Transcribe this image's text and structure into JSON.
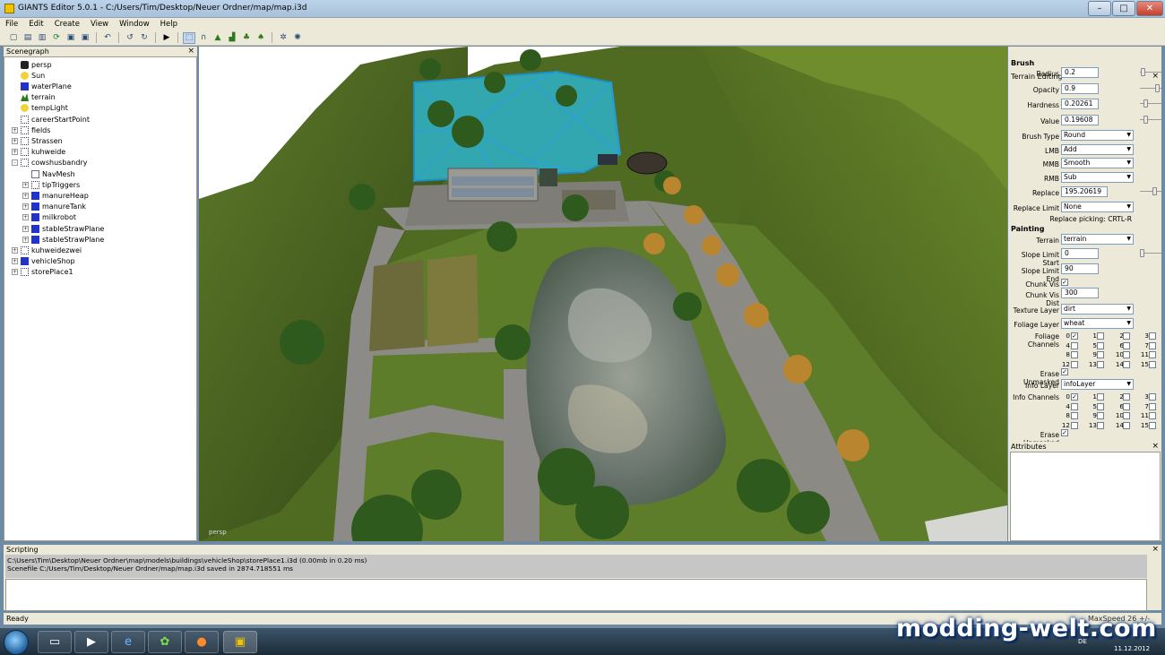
{
  "window": {
    "title": "GIANTS Editor 5.0.1 - C:/Users/Tim/Desktop/Neuer Ordner/map/map.i3d",
    "min": "–",
    "max": "□",
    "close": "✕"
  },
  "menu": [
    "File",
    "Edit",
    "Create",
    "View",
    "Window",
    "Help"
  ],
  "toolbar_icons": [
    "new-icon",
    "open-icon",
    "import-icon",
    "reload-icon",
    "save-icon",
    "save-as-icon",
    "undo-history-icon",
    "undo-icon",
    "redo-icon",
    "play-icon",
    "select-icon",
    "move-icon",
    "terrain-sculpt-icon",
    "terrain-paint-icon",
    "foliage-paint-icon",
    "tree-paint-icon",
    "navmesh-icon",
    "settings-icon"
  ],
  "scenegraph": {
    "title": "Scenegraph",
    "close": "×",
    "items": [
      {
        "label": "persp",
        "icon": "camera-icon",
        "depth": 0,
        "expander": ""
      },
      {
        "label": "Sun",
        "icon": "light-icon",
        "depth": 0,
        "expander": ""
      },
      {
        "label": "waterPlane",
        "icon": "shape-icon",
        "depth": 0,
        "expander": ""
      },
      {
        "label": "terrain",
        "icon": "terrain-icon",
        "depth": 0,
        "expander": ""
      },
      {
        "label": "tempLight",
        "icon": "light-icon",
        "depth": 0,
        "expander": ""
      },
      {
        "label": "careerStartPoint",
        "icon": "transform-icon",
        "depth": 0,
        "expander": ""
      },
      {
        "label": "fields",
        "icon": "transform-icon",
        "depth": 0,
        "expander": "+"
      },
      {
        "label": "Strassen",
        "icon": "transform-icon",
        "depth": 0,
        "expander": "+"
      },
      {
        "label": "kuhweide",
        "icon": "transform-icon",
        "depth": 0,
        "expander": "+"
      },
      {
        "label": "cowshusbandry",
        "icon": "transform-icon",
        "depth": 0,
        "expander": "-"
      },
      {
        "label": "NavMesh",
        "icon": "navmesh-icon",
        "depth": 1,
        "expander": ""
      },
      {
        "label": "tipTriggers",
        "icon": "transform-icon",
        "depth": 1,
        "expander": "+"
      },
      {
        "label": "manureHeap",
        "icon": "shape-icon",
        "depth": 1,
        "expander": "+"
      },
      {
        "label": "manureTank",
        "icon": "shape-icon",
        "depth": 1,
        "expander": "+"
      },
      {
        "label": "milkrobot",
        "icon": "shape-icon",
        "depth": 1,
        "expander": "+"
      },
      {
        "label": "stableStrawPlane",
        "icon": "shape-icon",
        "depth": 1,
        "expander": "+"
      },
      {
        "label": "stableStrawPlane",
        "icon": "shape-icon",
        "depth": 1,
        "expander": "+"
      },
      {
        "label": "kuhweidezwei",
        "icon": "transform-icon",
        "depth": 0,
        "expander": "+"
      },
      {
        "label": "vehicleShop",
        "icon": "shape-icon",
        "depth": 0,
        "expander": "+"
      },
      {
        "label": "storePlace1",
        "icon": "transform-icon",
        "depth": 0,
        "expander": "+"
      }
    ]
  },
  "viewport": {
    "camera_label": "persp"
  },
  "terrain_editing": {
    "title": "Terrain Editing",
    "close": "×",
    "brush_header": "Brush",
    "radius_label": "Radius",
    "radius": "0.2",
    "radius_level": 0.05,
    "opacity_label": "Opacity",
    "opacity": "0.9",
    "opacity_level": 0.9,
    "hardness_label": "Hardness",
    "hardness": "0.20261",
    "hardness_level": 0.2,
    "value_label": "Value",
    "value": "0.19608",
    "value_level": 0.2,
    "brush_type_label": "Brush Type",
    "brush_type": "Round",
    "lmb_label": "LMB",
    "lmb": "Add",
    "mmb_label": "MMB",
    "mmb": "Smooth",
    "rmb_label": "RMB",
    "rmb": "Sub",
    "replace_label": "Replace",
    "replace": "195.20619",
    "replace_level": 0.75,
    "replace_limit_label": "Replace Limit",
    "replace_limit": "None",
    "replace_hint": "Replace picking: CRTL-R",
    "painting_header": "Painting",
    "terrain_label": "Terrain",
    "terrain": "terrain",
    "slope_start_label": "Slope Limit Start",
    "slope_start": "0",
    "slope_start_level": 0,
    "slope_end_label": "Slope Limit End",
    "slope_end": "90",
    "chunk_vis_label": "Chunk Vis",
    "chunk_vis": "✓",
    "chunk_vis_dist_label": "Chunk Vis Dist",
    "chunk_vis_dist": "300",
    "texture_layer_label": "Texture Layer",
    "texture_layer": "dirt",
    "foliage_layer_label": "Foliage Layer",
    "foliage_layer": "wheat",
    "foliage_channels_label": "Foliage Channels",
    "foliage_channels": [
      {
        "n": "0",
        "c": "✓"
      },
      {
        "n": "1",
        "c": ""
      },
      {
        "n": "2",
        "c": ""
      },
      {
        "n": "3",
        "c": ""
      },
      {
        "n": "4",
        "c": ""
      },
      {
        "n": "5",
        "c": ""
      },
      {
        "n": "6",
        "c": ""
      },
      {
        "n": "7",
        "c": ""
      },
      {
        "n": "8",
        "c": ""
      },
      {
        "n": "9",
        "c": ""
      },
      {
        "n": "10",
        "c": ""
      },
      {
        "n": "11",
        "c": ""
      },
      {
        "n": "12",
        "c": ""
      },
      {
        "n": "13",
        "c": ""
      },
      {
        "n": "14",
        "c": ""
      },
      {
        "n": "15",
        "c": ""
      }
    ],
    "erase_unmasked_label": "Erase Unmasked",
    "erase_unmasked": "✓",
    "info_layer_label": "Info Layer",
    "info_layer": "infoLayer",
    "info_channels_label": "Info Channels",
    "info_channels": [
      {
        "n": "0",
        "c": "✓"
      },
      {
        "n": "1",
        "c": ""
      },
      {
        "n": "2",
        "c": ""
      },
      {
        "n": "3",
        "c": ""
      },
      {
        "n": "4",
        "c": ""
      },
      {
        "n": "5",
        "c": ""
      },
      {
        "n": "6",
        "c": ""
      },
      {
        "n": "7",
        "c": ""
      },
      {
        "n": "8",
        "c": ""
      },
      {
        "n": "9",
        "c": ""
      },
      {
        "n": "10",
        "c": ""
      },
      {
        "n": "11",
        "c": ""
      },
      {
        "n": "12",
        "c": ""
      },
      {
        "n": "13",
        "c": ""
      },
      {
        "n": "14",
        "c": ""
      },
      {
        "n": "15",
        "c": ""
      }
    ],
    "erase_unmasked2_label": "Erase Unmasked",
    "erase_unmasked2": "✓",
    "dropdown_arrow": "▼"
  },
  "attributes": {
    "title": "Attributes",
    "close": "×"
  },
  "scripting": {
    "title": "Scripting",
    "close": "×",
    "lines": [
      "C:\\Users\\Tim\\Desktop\\Neuer Ordner\\map\\models\\buildings\\vehicleShop\\storePlace1.i3d (0.00mb in 0.20 ms)",
      "Scenefile C:/Users/Tim/Desktop/Neuer Ordner/map/map.i3d saved in 2874.718551 ms"
    ]
  },
  "status": {
    "text": "Ready",
    "speed": "MaxSpeed 26 +/-"
  },
  "taskbar": {
    "lang": "DE",
    "date": "11.12.2012",
    "watermark": "modding-welt.com",
    "apps": [
      "explorer-icon",
      "media-player-icon",
      "internet-explorer-icon",
      "icq-icon",
      "firefox-icon",
      "giants-editor-icon"
    ]
  }
}
